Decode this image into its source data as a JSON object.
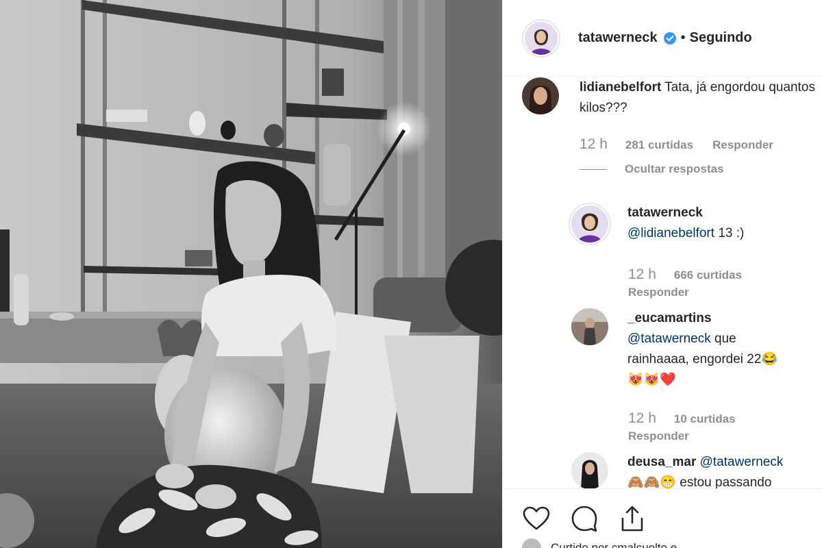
{
  "post": {
    "author": "tatawerneck",
    "follow_status": "Seguindo",
    "dot": "•"
  },
  "comments": [
    {
      "username": "lidianebelfort",
      "text": "Tata, já engordou quantos kilos???",
      "time": "12 h",
      "likes": "281 curtidas",
      "reply": "Responder",
      "hide_replies": "Ocultar respostas",
      "avatar_icon": "user-avatar"
    }
  ],
  "replies": [
    {
      "username": "tatawerneck",
      "mention": "@lidianebelfort",
      "text": "13 :)",
      "time": "12 h",
      "likes": "666 curtidas",
      "reply": "Responder"
    },
    {
      "username": "_eucamartins",
      "mention": "@tatawerneck",
      "text_line1": " que",
      "text_line2": "rainhaaaa, engordei 22",
      "emoji_end": "😂",
      "emoji_line": "😻😻❤️",
      "time": "12 h",
      "likes": "10 curtidas",
      "reply": "Responder"
    },
    {
      "username": "deusa_mar",
      "mention": "@tatawerneck",
      "text_partial": "🙈🙈😁 estou passando"
    }
  ],
  "actions": {
    "like_icon": "heart-icon",
    "comment_icon": "comment-icon",
    "share_icon": "share-icon",
    "liked_by_partial": "Curtido por cmalcuolto e"
  },
  "colors": {
    "verified": "#3897f0",
    "text": "#262626",
    "muted": "#8e8e8e",
    "mention": "#003569"
  }
}
